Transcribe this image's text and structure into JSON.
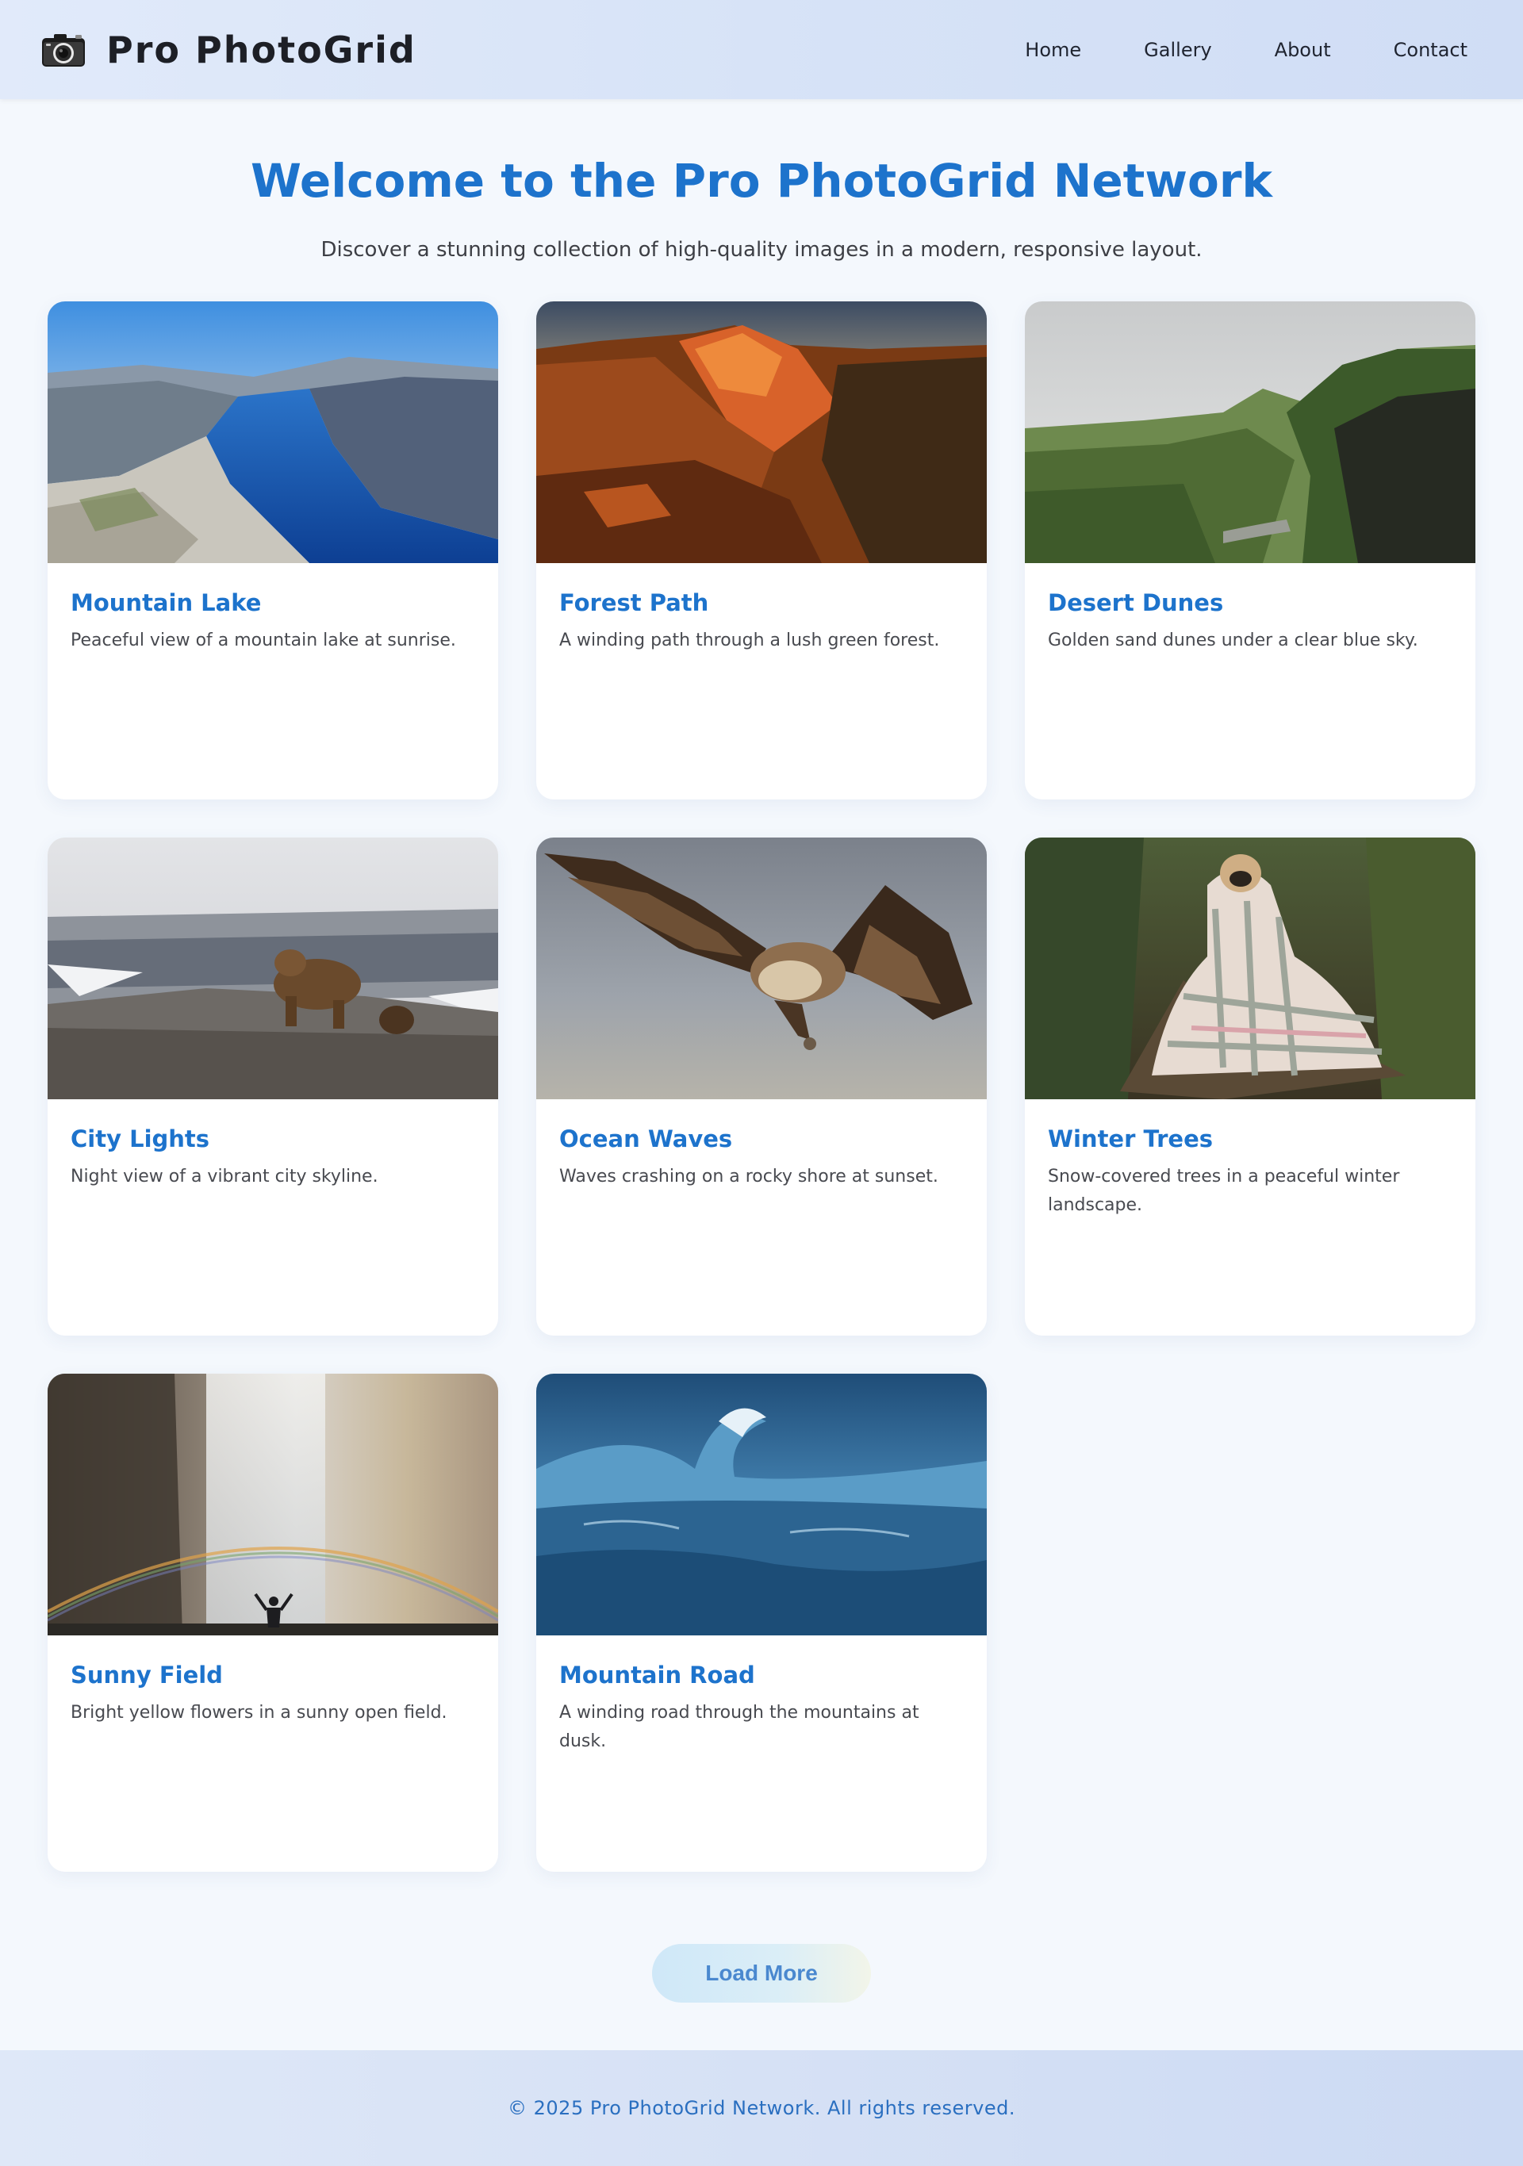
{
  "header": {
    "logo_text": "Pro PhotoGrid",
    "logo_icon": "camera-icon",
    "nav": [
      {
        "label": "Home"
      },
      {
        "label": "Gallery"
      },
      {
        "label": "About"
      },
      {
        "label": "Contact"
      }
    ]
  },
  "hero": {
    "title": "Welcome to the Pro PhotoGrid Network",
    "subtitle": "Discover a stunning collection of high-quality images in a modern, responsive layout."
  },
  "gallery": {
    "cards": [
      {
        "title": "Mountain Lake",
        "description": "Peaceful view of a mountain lake at sunrise."
      },
      {
        "title": "Forest Path",
        "description": "A winding path through a lush green forest."
      },
      {
        "title": "Desert Dunes",
        "description": "Golden sand dunes under a clear blue sky."
      },
      {
        "title": "City Lights",
        "description": "Night view of a vibrant city skyline."
      },
      {
        "title": "Ocean Waves",
        "description": "Waves crashing on a rocky shore at sunset."
      },
      {
        "title": "Winter Trees",
        "description": "Snow-covered trees in a peaceful winter landscape."
      },
      {
        "title": "Sunny Field",
        "description": "Bright yellow flowers in a sunny open field."
      },
      {
        "title": "Mountain Road",
        "description": "A winding road through the mountains at dusk."
      }
    ]
  },
  "load_more_label": "Load More",
  "footer": {
    "text": "© 2025 Pro PhotoGrid Network. All rights reserved."
  },
  "colors": {
    "accent": "#1d73cc",
    "page_background": "#f4f8fd",
    "card_background": "#ffffff"
  }
}
